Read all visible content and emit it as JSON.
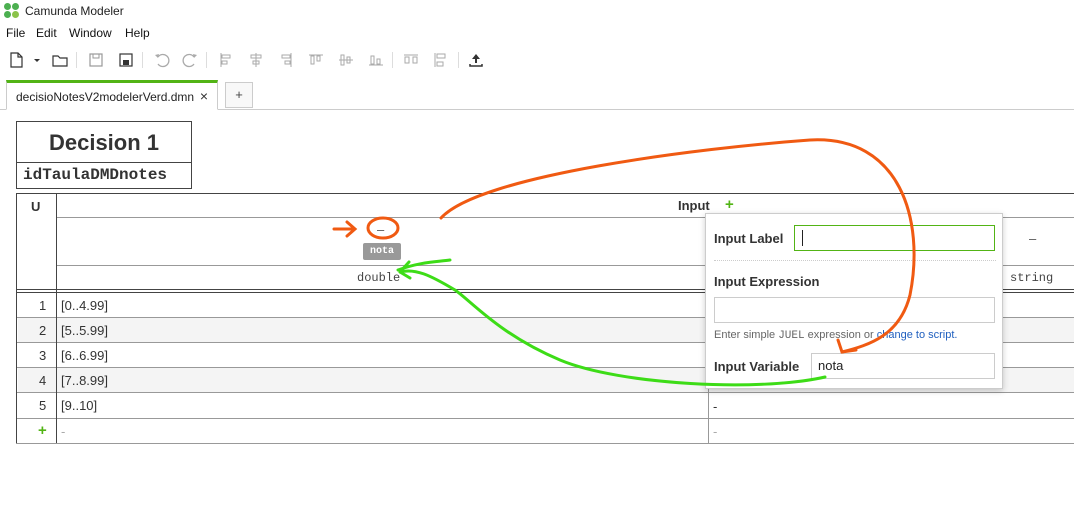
{
  "app": {
    "title": "Camunda Modeler"
  },
  "menu": {
    "items": [
      "File",
      "Edit",
      "Window",
      "Help"
    ]
  },
  "toolbar": {
    "icons": [
      "new-file-icon",
      "open-folder-icon",
      "save-icon",
      "save-as-icon",
      "undo-icon",
      "redo-icon",
      "align-left-icon",
      "align-center-icon",
      "align-right-icon",
      "align-top-icon",
      "align-middle-icon",
      "align-bottom-icon",
      "distribute-horizontal-icon",
      "distribute-vertical-icon",
      "deploy-icon"
    ]
  },
  "tabs": {
    "active_label": "decisioNotesV2modelerVerd.dmn",
    "close": "×",
    "add": "+"
  },
  "decision": {
    "name": "Decision 1",
    "id": "idTaulaDMDnotes"
  },
  "table": {
    "hit_policy": "U",
    "input_header": "Input",
    "add_input": "+",
    "input_label_placeholder": "–",
    "input_variable_badge": "nota",
    "input_type": "double",
    "output_placeholder": "–",
    "output_type": "string",
    "rows": [
      {
        "num": "1",
        "input": "[0..4.99]",
        "output": ""
      },
      {
        "num": "2",
        "input": "[5..5.99]",
        "output": ""
      },
      {
        "num": "3",
        "input": "[6..6.99]",
        "output": ""
      },
      {
        "num": "4",
        "input": "[7..8.99]",
        "output": ""
      },
      {
        "num": "5",
        "input": "[9..10]",
        "output": "-"
      }
    ],
    "add_row": {
      "num": "+",
      "input": "-",
      "output": "-"
    }
  },
  "popup": {
    "input_label_title": "Input Label",
    "input_label_value": "",
    "input_expression_title": "Input Expression",
    "input_expression_value": "",
    "hint_prefix": "Enter simple ",
    "hint_code": "JUEL",
    "hint_mid": " expression or ",
    "hint_link": "change to script.",
    "input_variable_title": "Input Variable",
    "input_variable_value": "nota"
  },
  "colors": {
    "accent_green": "#52b415",
    "annotation_orange": "#f05a12",
    "annotation_green": "#3ddc17",
    "link_blue": "#1f5fbf"
  }
}
